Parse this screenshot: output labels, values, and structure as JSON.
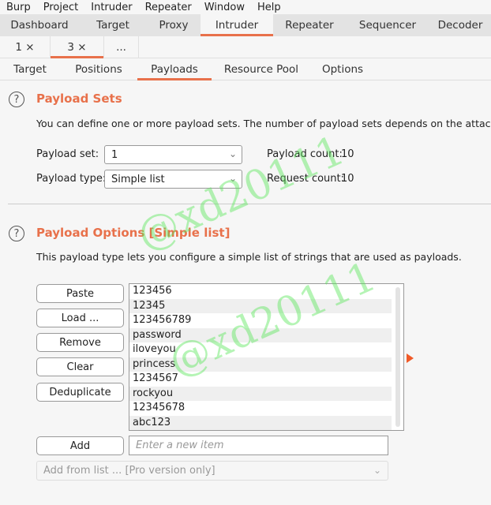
{
  "menubar": [
    "Burp",
    "Project",
    "Intruder",
    "Repeater",
    "Window",
    "Help"
  ],
  "top_tabs": [
    {
      "label": "Dashboard",
      "active": false
    },
    {
      "label": "Target",
      "active": false
    },
    {
      "label": "Proxy",
      "active": false
    },
    {
      "label": "Intruder",
      "active": true
    },
    {
      "label": "Repeater",
      "active": false
    },
    {
      "label": "Sequencer",
      "active": false
    },
    {
      "label": "Decoder",
      "active": false
    }
  ],
  "attack_tabs": [
    {
      "label": "1 ×",
      "active": false
    },
    {
      "label": "3 ×",
      "active": true
    },
    {
      "label": "...",
      "active": false
    }
  ],
  "inner_tabs": [
    {
      "label": "Target",
      "active": false
    },
    {
      "label": "Positions",
      "active": false
    },
    {
      "label": "Payloads",
      "active": true
    },
    {
      "label": "Resource Pool",
      "active": false
    },
    {
      "label": "Options",
      "active": false
    }
  ],
  "payload_sets": {
    "help_icon": "?",
    "title": "Payload Sets",
    "description": "You can define one or more payload sets. The number of payload sets depends on the attack type defined in the Positions tab.",
    "payload_set_label": "Payload set:",
    "payload_set_value": "1",
    "payload_type_label": "Payload type:",
    "payload_type_value": "Simple list",
    "payload_count_label": "Payload count:",
    "payload_count_value": "10",
    "request_count_label": "Request count:",
    "request_count_value": "10"
  },
  "payload_options": {
    "help_icon": "?",
    "title": "Payload Options [Simple list]",
    "description": "This payload type lets you configure a simple list of strings that are used as payloads.",
    "buttons": {
      "paste": "Paste",
      "load": "Load ...",
      "remove": "Remove",
      "clear": "Clear",
      "deduplicate": "Deduplicate",
      "add": "Add"
    },
    "items": [
      "123456",
      "12345",
      "123456789",
      "password",
      "iloveyou",
      "princess",
      "1234567",
      "rockyou",
      "12345678",
      "abc123"
    ],
    "new_item_placeholder": "Enter a new item",
    "add_from_list": "Add from list ... [Pro version only]"
  },
  "watermark": "@xd20111",
  "colors": {
    "accent": "#e8714b",
    "arrow": "#f05a28"
  }
}
